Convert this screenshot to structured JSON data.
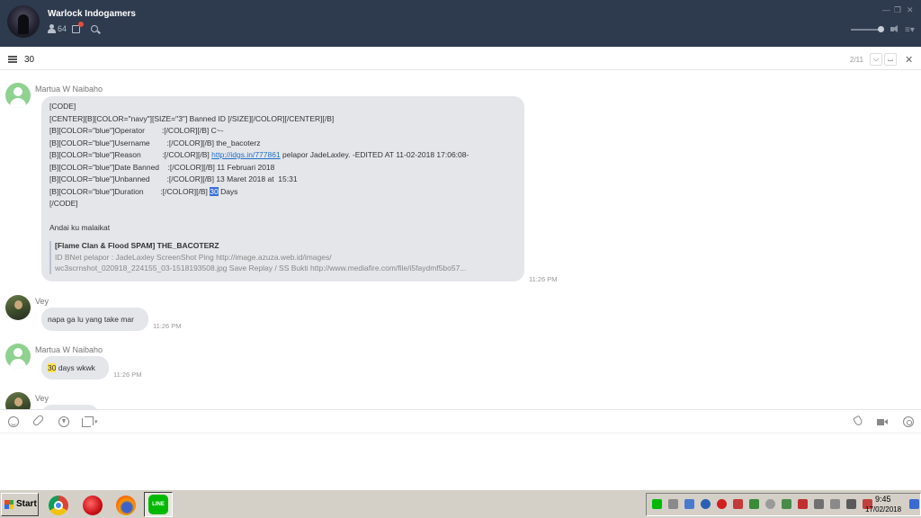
{
  "header": {
    "group_name": "Warlock Indogamers",
    "member_count": "64",
    "icons": [
      "members-icon",
      "notes-icon",
      "search-icon"
    ]
  },
  "window_controls": [
    "minimize-icon",
    "restore-icon",
    "close-icon"
  ],
  "search": {
    "query": "30",
    "result_position": "2/11"
  },
  "messages": [
    {
      "sender": "Martua W Naibaho",
      "time": "11:26 PM",
      "lines": [
        "[CODE]",
        "[CENTER][B][COLOR=\"navy\"][SIZE=\"3\"] Banned ID [/SIZE][/COLOR][/CENTER][/B]",
        "[B][COLOR=\"blue\"]Operator        :[/COLOR][/B] C~-",
        "[B][COLOR=\"blue\"]Username        :[/COLOR][/B] the_bacoterz",
        "[B][COLOR=\"blue\"]Reason          :[/COLOR][/B] ",
        "[B][COLOR=\"blue\"]Date Banned    :[/COLOR][/B] 11 Februari 2018",
        "[B][COLOR=\"blue\"]Unbanned        :[/COLOR][/B] 13 Maret 2018 at  15:31",
        "[B][COLOR=\"blue\"]Duration        :[/COLOR][/B] ",
        "[/CODE]",
        "",
        "Andai ku malaikat"
      ],
      "reason_link": "http://idgs.in/777861",
      "reason_rest": " pelapor JadeLaxley. -EDITED AT 11-02-2018 17:06:08-",
      "duration_value": "30",
      "duration_unit": " Days",
      "quote_title": "[Flame Clan & Flood SPAM] THE_BACOTERZ",
      "quote_line1": "ID BNet pelapor : JadeLaxley ScreenShot Ping http://image.azuza.web.id/images/",
      "quote_line2": "wc3scrnshot_020918_224155_03-1518193508.jpg Save Replay / SS Bukti http://www.mediafire.com/file/i5faydmf5bo57..."
    },
    {
      "sender": "Vey",
      "text": "napa ga lu yang take mar",
      "time": "11:26 PM"
    },
    {
      "sender": "Martua W Naibaho",
      "highlight": "30",
      "text": " days wkwk",
      "time": "11:26 PM"
    },
    {
      "sender": "Vey"
    }
  ],
  "taskbar": {
    "start_label": "Start",
    "apps": [
      "chrome-icon",
      "opera-icon",
      "firefox-icon",
      "line-icon"
    ],
    "line_label": "LINE",
    "clock_time": "9:45",
    "clock_date": "17/02/2018"
  },
  "colors": {
    "header_bg": "#2e3a4d",
    "bubble_bg": "#e4e6ea",
    "search_highlight": "#ffe14d",
    "current_highlight": "#3a6fd8",
    "link": "#1f6fc8"
  }
}
